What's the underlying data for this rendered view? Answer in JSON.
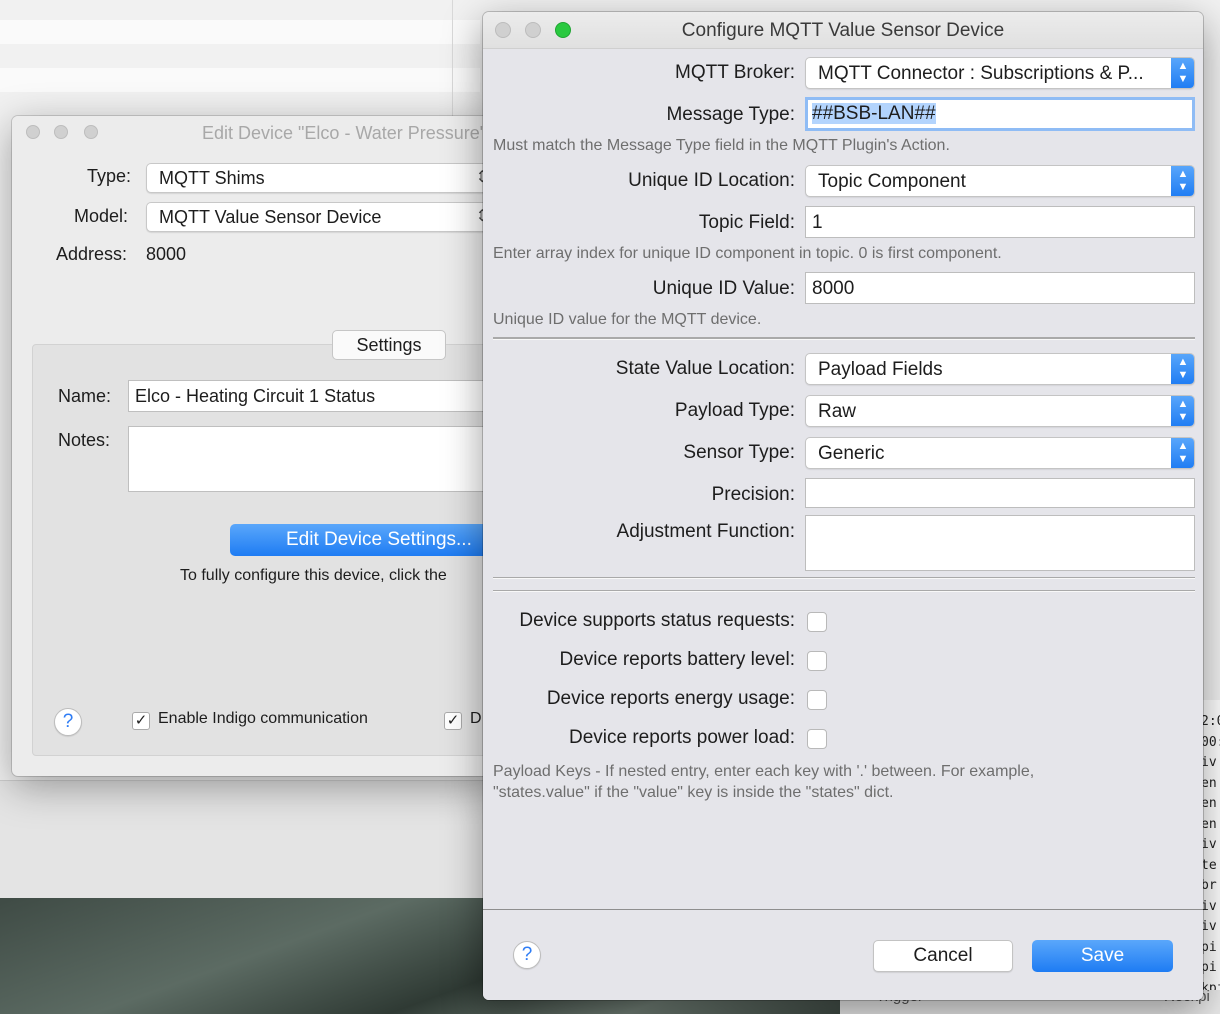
{
  "background": {
    "mono_lines": [
      "2:0",
      "00:",
      "iv",
      "en",
      "en",
      "en",
      "iv",
      "te",
      "br",
      "iv",
      "iv",
      "pi",
      "pi",
      "kpi"
    ],
    "bottom_left_text": "Trigger",
    "bottom_right_text": "Rockpi"
  },
  "edit_device_window": {
    "title": "Edit Device \"Elco - Water Pressure\"",
    "type_label": "Type:",
    "type_value": "MQTT Shims",
    "model_label": "Model:",
    "model_value": "MQTT Value Sensor Device",
    "address_label": "Address:",
    "address_value": "8000",
    "settings_tab": "Settings",
    "name_label": "Name:",
    "name_value": "Elco - Heating Circuit 1 Status",
    "notes_label": "Notes:",
    "notes_value": "",
    "edit_settings_button": "Edit Device Settings...",
    "configure_hint": "To fully configure this device, click the",
    "help_icon": "?",
    "enable_comm_label": "Enable Indigo communication",
    "second_check_label": "D"
  },
  "mqtt_dialog": {
    "title": "Configure MQTT Value Sensor Device",
    "broker_label": "MQTT Broker:",
    "broker_value": "MQTT Connector : Subscriptions & P...",
    "message_type_label": "Message Type:",
    "message_type_value": "##BSB-LAN##",
    "message_type_hint": "Must match the Message Type field in the MQTT Plugin's Action.",
    "uid_location_label": "Unique ID Location:",
    "uid_location_value": "Topic Component",
    "topic_field_label": "Topic Field:",
    "topic_field_value": "1",
    "topic_field_hint": "Enter array index for unique ID component in topic.  0 is first component.",
    "uid_value_label": "Unique ID Value:",
    "uid_value_value": "8000",
    "uid_value_hint": "Unique ID value for the MQTT device.",
    "state_location_label": "State Value Location:",
    "state_location_value": "Payload Fields",
    "payload_type_label": "Payload Type:",
    "payload_type_value": "Raw",
    "sensor_type_label": "Sensor Type:",
    "sensor_type_value": "Generic",
    "precision_label": "Precision:",
    "precision_value": "",
    "adjustment_label": "Adjustment Function:",
    "adjustment_value": "",
    "status_requests_label": "Device supports status requests:",
    "battery_label": "Device reports battery level:",
    "energy_label": "Device reports energy usage:",
    "power_label": "Device reports power load:",
    "payload_keys_hint_1": "Payload Keys - If nested entry, enter each key with '.' between.  For example,",
    "payload_keys_hint_2": "\"states.value\" if the \"value\" key is inside the \"states\" dict.",
    "help_icon": "?",
    "cancel_button": "Cancel",
    "save_button": "Save"
  },
  "colors": {
    "accent": "#1e7cf3",
    "close": "#d0d0d0",
    "zoom": "#2ac940"
  }
}
